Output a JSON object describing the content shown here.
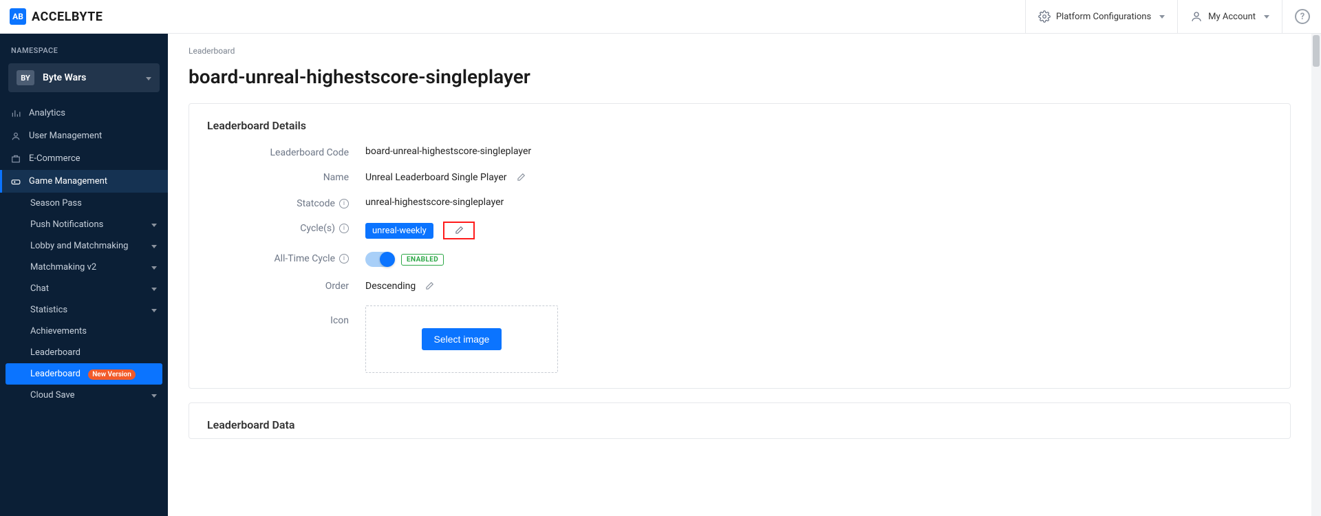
{
  "brand": {
    "logo_text": "AB",
    "name": "ACCELBYTE"
  },
  "topbar": {
    "platform_config": "Platform Configurations",
    "my_account": "My Account"
  },
  "sidebar": {
    "section_label": "NAMESPACE",
    "namespace": {
      "badge": "BY",
      "name": "Byte Wars"
    },
    "items": [
      {
        "label": "Analytics"
      },
      {
        "label": "User Management"
      },
      {
        "label": "E-Commerce"
      },
      {
        "label": "Game Management"
      }
    ],
    "subitems": [
      {
        "label": "Season Pass",
        "expandable": false
      },
      {
        "label": "Push Notifications",
        "expandable": true
      },
      {
        "label": "Lobby and Matchmaking",
        "expandable": true
      },
      {
        "label": "Matchmaking v2",
        "expandable": true
      },
      {
        "label": "Chat",
        "expandable": true
      },
      {
        "label": "Statistics",
        "expandable": true
      },
      {
        "label": "Achievements",
        "expandable": false
      },
      {
        "label": "Leaderboard",
        "expandable": false
      },
      {
        "label": "Leaderboard",
        "expandable": false,
        "new": "New Version"
      },
      {
        "label": "Cloud Save",
        "expandable": true
      }
    ]
  },
  "main": {
    "breadcrumb": "Leaderboard",
    "title": "board-unreal-highestscore-singleplayer",
    "details_card_title": "Leaderboard Details",
    "data_card_title": "Leaderboard Data",
    "labels": {
      "code": "Leaderboard Code",
      "name": "Name",
      "statcode": "Statcode",
      "cycles": "Cycle(s)",
      "alltime": "All-Time Cycle",
      "order": "Order",
      "icon": "Icon"
    },
    "values": {
      "code": "board-unreal-highestscore-singleplayer",
      "name": "Unreal Leaderboard Single Player",
      "statcode": "unreal-highestscore-singleplayer",
      "cycle_tag": "unreal-weekly",
      "alltime_status": "ENABLED",
      "order": "Descending",
      "select_image_btn": "Select image"
    }
  }
}
